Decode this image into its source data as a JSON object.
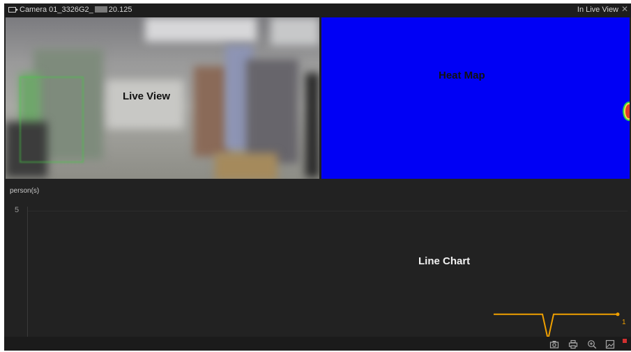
{
  "window": {
    "title_prefix": "Camera 01_3326G2_",
    "title_suffix": "20.125",
    "status": "In Live View",
    "close_glyph": "✕"
  },
  "live_view": {
    "label": "Live View"
  },
  "heat_map": {
    "label": "Heat Map",
    "background_color": "#0000f5"
  },
  "line_chart": {
    "label": "Line Chart",
    "y_axis_unit": "person(s)",
    "y_tick": "5",
    "end_value_label": "1",
    "line_color": "#f0a000"
  },
  "chart_data": {
    "type": "line",
    "title": "",
    "ylabel": "person(s)",
    "ylim": [
      0,
      5
    ],
    "series": [
      {
        "values": [
          1,
          1,
          0,
          1,
          1,
          1
        ]
      }
    ]
  },
  "toolbar": {
    "icons": [
      "camera-icon",
      "print-icon",
      "zoom-in-icon",
      "image-icon"
    ]
  }
}
